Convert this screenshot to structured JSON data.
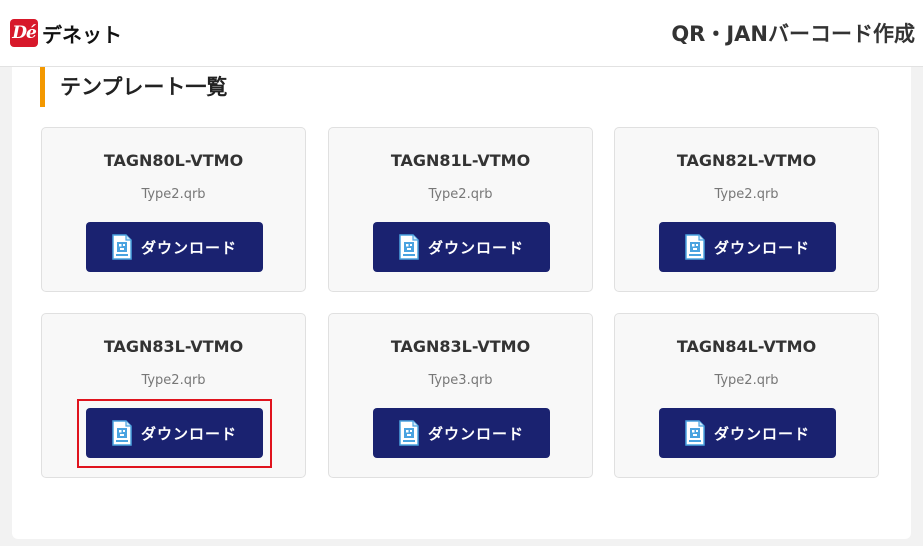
{
  "header": {
    "logo_mark": "Dé",
    "logo_text": "デネット",
    "title": "QR・JANバーコード作成"
  },
  "section": {
    "title": "テンプレート一覧"
  },
  "templates": [
    {
      "name": "TAGN80L-VTMO",
      "file": "Type2.qrb",
      "button_label": "ダウンロード"
    },
    {
      "name": "TAGN81L-VTMO",
      "file": "Type2.qrb",
      "button_label": "ダウンロード"
    },
    {
      "name": "TAGN82L-VTMO",
      "file": "Type2.qrb",
      "button_label": "ダウンロード"
    },
    {
      "name": "TAGN83L-VTMO",
      "file": "Type2.qrb",
      "button_label": "ダウンロード"
    },
    {
      "name": "TAGN83L-VTMO",
      "file": "Type3.qrb",
      "button_label": "ダウンロード"
    },
    {
      "name": "TAGN84L-VTMO",
      "file": "Type2.qrb",
      "button_label": "ダウンロード"
    }
  ],
  "icons": {
    "button_icon": "qr-file-icon"
  },
  "colors": {
    "brand_red": "#d7182a",
    "accent_orange": "#f39800",
    "button_navy": "#1a2270",
    "highlight_red": "#e0141e"
  }
}
